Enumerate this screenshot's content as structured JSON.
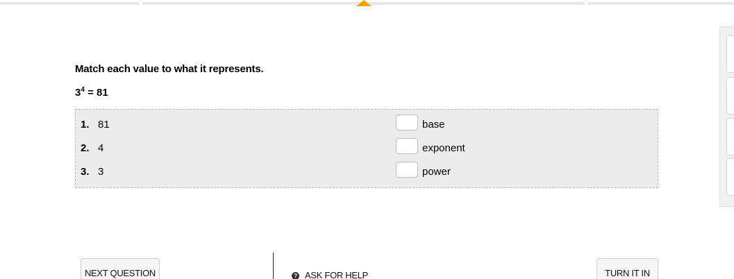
{
  "progress": {
    "accent_color": "#f4a300"
  },
  "question": {
    "prompt": "Match each value to what it represents.",
    "equation": {
      "base": "3",
      "exponent": "4",
      "rest": " = 81"
    }
  },
  "matching": {
    "left": [
      {
        "num": "1.",
        "value": "81"
      },
      {
        "num": "2.",
        "value": "4"
      },
      {
        "num": "3.",
        "value": "3"
      }
    ],
    "right": [
      "base",
      "exponent",
      "power"
    ]
  },
  "footer": {
    "next_label": "NEXT QUESTION",
    "help_icon": "question-circle-icon",
    "help_label": "ASK FOR HELP",
    "turn_in_label": "TURN IT IN"
  }
}
